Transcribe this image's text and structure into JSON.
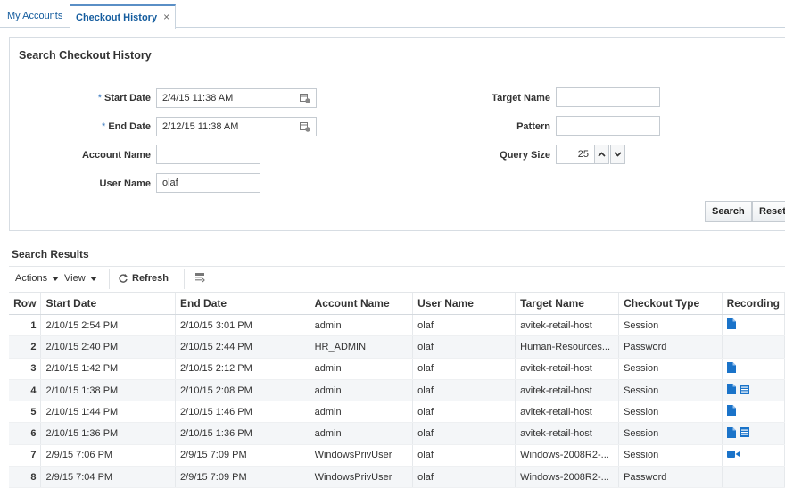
{
  "tabs": [
    {
      "label": "My Accounts"
    },
    {
      "label": "Checkout History",
      "close": "×"
    }
  ],
  "search": {
    "title": "Search Checkout History",
    "required_mark": "*",
    "start_date": {
      "label": "Start Date",
      "value": "2/4/15 11:38 AM"
    },
    "end_date": {
      "label": "End Date",
      "value": "2/12/15 11:38 AM"
    },
    "account_name": {
      "label": "Account Name",
      "value": ""
    },
    "user_name": {
      "label": "User Name",
      "value": "olaf"
    },
    "target_name": {
      "label": "Target Name",
      "value": ""
    },
    "pattern": {
      "label": "Pattern",
      "value": ""
    },
    "query_size": {
      "label": "Query Size",
      "value": "25"
    },
    "search_button": "Search",
    "reset_button": "Reset"
  },
  "results": {
    "title": "Search Results",
    "toolbar": {
      "actions": "Actions",
      "view": "View",
      "refresh": "Refresh"
    },
    "columns": [
      "Row",
      "Start Date",
      "End Date",
      "Account Name",
      "User Name",
      "Target Name",
      "Checkout Type",
      "Recording"
    ],
    "rows": [
      {
        "row": "1",
        "start": "2/10/15 2:54 PM",
        "end": "2/10/15 3:01 PM",
        "account": "admin",
        "user": "olaf",
        "target": "avitek-retail-host",
        "type": "Session",
        "recording": [
          "document-icon"
        ]
      },
      {
        "row": "2",
        "start": "2/10/15 2:40 PM",
        "end": "2/10/15 2:44 PM",
        "account": "HR_ADMIN",
        "user": "olaf",
        "target": "Human-Resources...",
        "type": "Password",
        "recording": []
      },
      {
        "row": "3",
        "start": "2/10/15 1:42 PM",
        "end": "2/10/15 2:12 PM",
        "account": "admin",
        "user": "olaf",
        "target": "avitek-retail-host",
        "type": "Session",
        "recording": [
          "document-icon"
        ]
      },
      {
        "row": "4",
        "start": "2/10/15 1:38 PM",
        "end": "2/10/15 2:08 PM",
        "account": "admin",
        "user": "olaf",
        "target": "avitek-retail-host",
        "type": "Session",
        "recording": [
          "document-icon",
          "transcript-icon"
        ]
      },
      {
        "row": "5",
        "start": "2/10/15 1:44 PM",
        "end": "2/10/15 1:46 PM",
        "account": "admin",
        "user": "olaf",
        "target": "avitek-retail-host",
        "type": "Session",
        "recording": [
          "document-icon"
        ]
      },
      {
        "row": "6",
        "start": "2/10/15 1:36 PM",
        "end": "2/10/15 1:36 PM",
        "account": "admin",
        "user": "olaf",
        "target": "avitek-retail-host",
        "type": "Session",
        "recording": [
          "document-icon",
          "transcript-icon"
        ]
      },
      {
        "row": "7",
        "start": "2/9/15 7:06 PM",
        "end": "2/9/15 7:09 PM",
        "account": "WindowsPrivUser",
        "user": "olaf",
        "target": "Windows-2008R2-...",
        "type": "Session",
        "recording": [
          "video-icon"
        ]
      },
      {
        "row": "8",
        "start": "2/9/15 7:04 PM",
        "end": "2/9/15 7:09 PM",
        "account": "WindowsPrivUser",
        "user": "olaf",
        "target": "Windows-2008R2-...",
        "type": "Password",
        "recording": []
      }
    ]
  },
  "colors": {
    "accent": "#145c9e",
    "icon_blue": "#1a73c9",
    "alt_row": "#f4f6f8"
  }
}
